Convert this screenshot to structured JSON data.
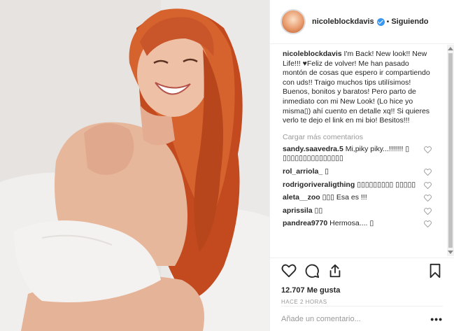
{
  "post": {
    "username": "nicoleblockdavis",
    "separator": "•",
    "follow_status": "Siguiendo",
    "caption_user": "nicoleblockdavis",
    "caption_text": "I'm Back! New look!! New Life!!! ♥Feliz de volver! Me han pasado montón de cosas que espero ir compartiendo con uds!! Traigo muchos tips utilísimos! Buenos, bonitos y baratos! Pero parto de inmediato con mi New Look! (Lo hice yo misma▯) ahí cuento en detalle xq!! Si quieres verlo te dejo el link en mi bio! Besitos!!!",
    "load_more": "Cargar más comentarios",
    "comments": [
      {
        "user": "sandy.saavedra.5",
        "text": "Mi,piky piky...!!!!!!! ▯ ▯▯▯▯▯▯▯▯▯▯▯▯▯▯▯"
      },
      {
        "user": "rol_arriola_",
        "text": "▯"
      },
      {
        "user": "rodrigoriveraligthing",
        "text": "▯▯▯▯▯▯▯▯▯ ▯▯▯▯▯"
      },
      {
        "user": "aleta__zoo",
        "text": "▯▯▯ Esa es !!!"
      },
      {
        "user": "aprissila",
        "text": "▯▯"
      },
      {
        "user": "pandrea9770",
        "text": "Hermosa.... ▯"
      }
    ],
    "likes": "12.707 Me gusta",
    "time_ago": "HACE 2 HORAS",
    "comment_placeholder": "Añade un comentario...",
    "more_options": "•••"
  },
  "colors": {
    "verified": "#3897f0",
    "muted_text": "#999999",
    "text": "#262626"
  },
  "icons": [
    "heart-icon",
    "comment-icon",
    "share-icon",
    "bookmark-icon",
    "verified-badge-icon"
  ]
}
